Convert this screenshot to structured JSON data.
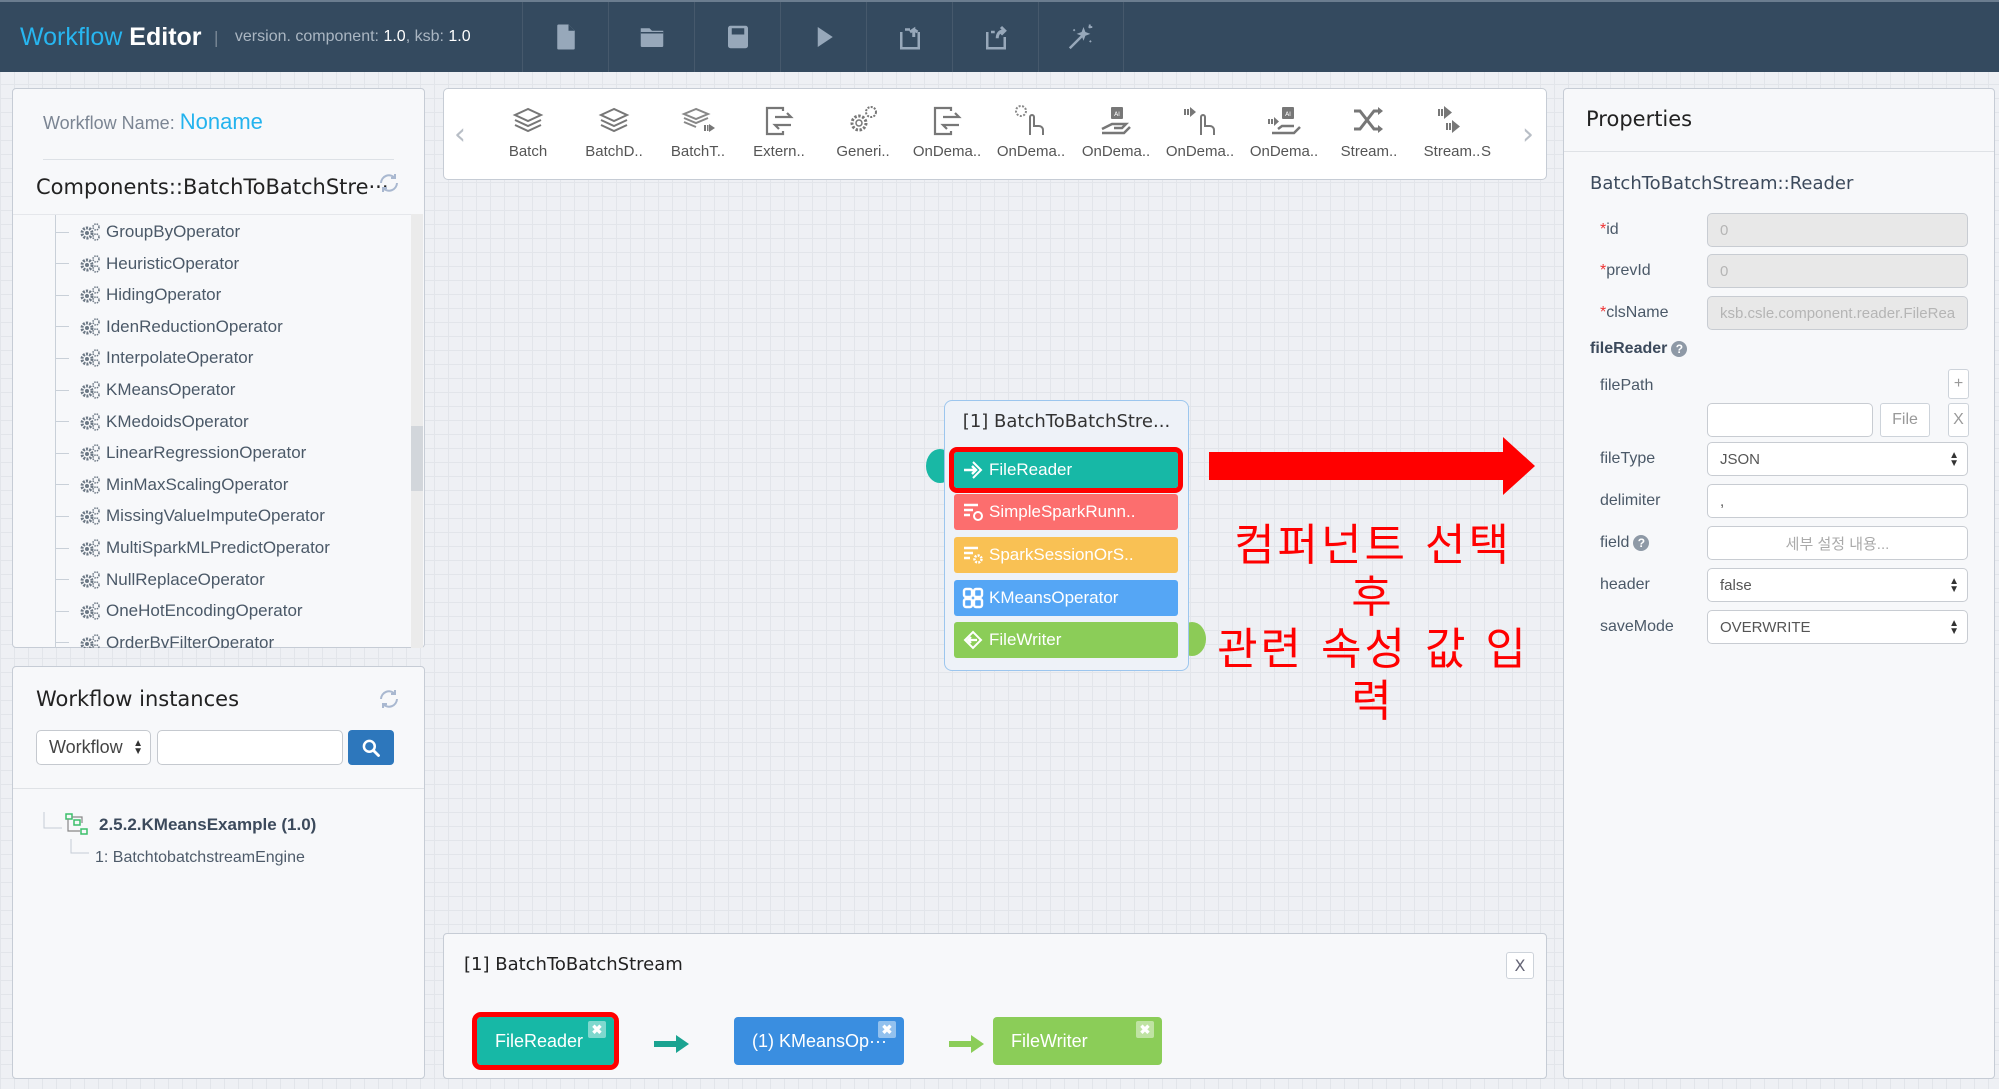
{
  "header": {
    "brand_part1": "Workflow",
    "brand_part2": "Editor",
    "separator": "|",
    "version_prefix": "version. component:",
    "component_version": "1.0",
    "ksb_prefix": ", ksb:",
    "ksb_version": "1.0",
    "buttons": [
      {
        "name": "new-file",
        "icon": "file-icon"
      },
      {
        "name": "open",
        "icon": "folder-icon"
      },
      {
        "name": "save",
        "icon": "save-icon"
      },
      {
        "name": "run",
        "icon": "play-icon"
      },
      {
        "name": "import",
        "icon": "import-icon"
      },
      {
        "name": "export",
        "icon": "export-icon"
      },
      {
        "name": "magic",
        "icon": "magic-wand-icon"
      }
    ]
  },
  "components_panel": {
    "workflow_name_label": "Workflow Name:",
    "workflow_name_value": "Noname",
    "title": "Components::BatchToBatchStre···",
    "items": [
      "GroupByOperator",
      "HeuristicOperator",
      "HidingOperator",
      "IdenReductionOperator",
      "InterpolateOperator",
      "KMeansOperator",
      "KMedoidsOperator",
      "LinearRegressionOperator",
      "MinMaxScalingOperator",
      "MissingValueImputeOperator",
      "MultiSparkMLPredictOperator",
      "NullReplaceOperator",
      "OneHotEncodingOperator",
      "OrderByFilterOperator"
    ]
  },
  "instances_panel": {
    "title": "Workflow instances",
    "filter_select": "Workflow",
    "search_value": "",
    "tree": {
      "label": "2.5.2.KMeansExample (1.0)",
      "child": "1: BatchtobatchstreamEngine"
    }
  },
  "palette": {
    "items": [
      {
        "label": "Batch",
        "icon": "layers-icon"
      },
      {
        "label": "BatchD..",
        "icon": "layers-icon"
      },
      {
        "label": "BatchT..",
        "icon": "layers-stream-icon"
      },
      {
        "label": "Extern..",
        "icon": "exchange-box-icon"
      },
      {
        "label": "Generi..",
        "icon": "gears-icon"
      },
      {
        "label": "OnDema..",
        "icon": "exchange-box-icon"
      },
      {
        "label": "OnDema..",
        "icon": "hand-pointer-icon"
      },
      {
        "label": "OnDema..",
        "icon": "ai-chip-hand-icon"
      },
      {
        "label": "OnDema..",
        "icon": "stream-hand-icon"
      },
      {
        "label": "OnDema..",
        "icon": "ai-chip-stream-icon"
      },
      {
        "label": "Stream..",
        "icon": "shuffle-icon"
      },
      {
        "label": "Stream..",
        "icon": "stream-arrows-icon"
      },
      {
        "label": "S",
        "icon": ""
      }
    ]
  },
  "node": {
    "title": "[1] BatchToBatchStre...",
    "components": [
      {
        "label": "FileReader",
        "color": "#17b8a6",
        "icon": "reader-icon",
        "selected": true
      },
      {
        "label": "SimpleSparkRunn..",
        "color": "#fc6e6e",
        "icon": "runner-icon",
        "selected": false
      },
      {
        "label": "SparkSessionOrS..",
        "color": "#f9c154",
        "icon": "session-icon",
        "selected": false
      },
      {
        "label": "KMeansOperator",
        "color": "#55a6f5",
        "icon": "operator-grid-icon",
        "selected": false
      },
      {
        "label": "FileWriter",
        "color": "#8bcd58",
        "icon": "writer-icon",
        "selected": false
      }
    ]
  },
  "annotation": {
    "line1": "컴퍼넌트 선택 후",
    "line2": "관련 속성 값 입력",
    "color": "#ff0000"
  },
  "pipeline": {
    "title": "[1] BatchToBatchStream",
    "close_label": "X",
    "boxes": [
      {
        "label": "FileReader",
        "color": "#17b8a6"
      },
      {
        "label": "(1) KMeansOp···",
        "color": "#3a8ee0"
      },
      {
        "label": "FileWriter",
        "color": "#8bcd58"
      }
    ],
    "remove_label": "✖"
  },
  "properties": {
    "title": "Properties",
    "subtitle": "BatchToBatchStream::Reader",
    "required_mark": "*",
    "fields": {
      "id": {
        "label": "id",
        "value": "0"
      },
      "prevId": {
        "label": "prevId",
        "value": "0"
      },
      "clsName": {
        "label": "clsName",
        "value": "ksb.csle.component.reader.FileRea"
      }
    },
    "section": "fileReader",
    "filePath_label": "filePath",
    "filePath_value": "",
    "add_label": "+",
    "file_button": "File",
    "remove_label": "X",
    "fileType_label": "fileType",
    "fileType_value": "JSON",
    "delimiter_label": "delimiter",
    "delimiter_value": ",",
    "field_label": "field",
    "field_value": "세부 설정 내용...",
    "header_label": "header",
    "header_value": "false",
    "saveMode_label": "saveMode",
    "saveMode_value": "OVERWRITE",
    "help_glyph": "?"
  }
}
